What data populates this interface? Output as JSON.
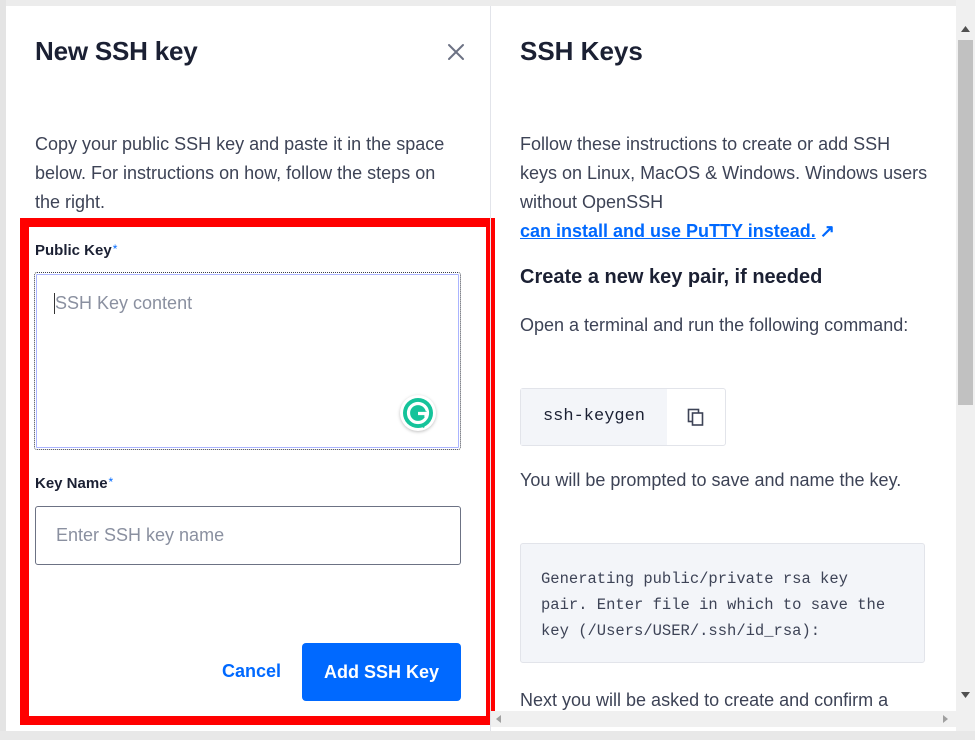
{
  "left": {
    "title": "New SSH key",
    "intro": "Copy your public SSH key and paste it in the space below. For instructions on how, follow the steps on the right.",
    "public_key_label": "Public Key",
    "public_key_placeholder": "SSH Key content",
    "key_name_label": "Key Name",
    "key_name_placeholder": "Enter SSH key name",
    "required_marker": "*",
    "cancel_label": "Cancel",
    "submit_label": "Add SSH Key"
  },
  "right": {
    "title": "SSH Keys",
    "intro": "Follow these instructions to create or add SSH keys on Linux, MacOS & Windows. Windows users without OpenSSH",
    "link_text": "can install and use PuTTY instead.",
    "link_arrow": "↗",
    "heading": "Create a new key pair, if needed",
    "step1": "Open a terminal and run the following command:",
    "command": "ssh-keygen",
    "step2": "You will be prompted to save and name the key.",
    "output": "Generating public/private rsa key\npair. Enter file in which to save the\nkey (/Users/USER/.ssh/id_rsa):",
    "step3": "Next you will be asked to create and confirm a"
  },
  "colors": {
    "accent": "#0069ff",
    "highlight": "#ff0000",
    "text": "#1b2033"
  },
  "icons": {
    "close": "close-icon",
    "copy": "copy-icon",
    "grammarly": "grammarly-icon",
    "external_link": "external-link-icon"
  }
}
